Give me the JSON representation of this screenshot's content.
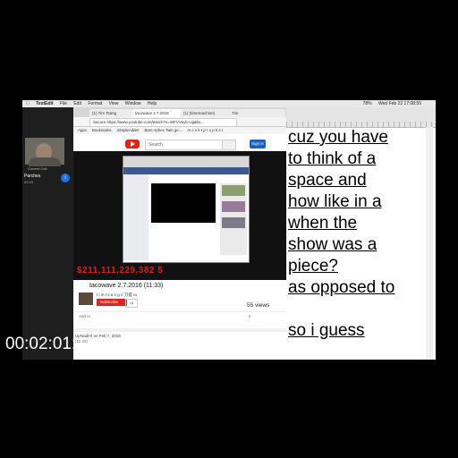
{
  "menubar": {
    "app": "TextEdit",
    "items": [
      "File",
      "Edit",
      "Format",
      "View",
      "Window",
      "Help"
    ],
    "clock": "Wed Feb 22  17:08:55",
    "battery": "78%"
  },
  "call": {
    "label": "Current Call",
    "contact": "Parches",
    "duration": "02:43"
  },
  "browser": {
    "tabs": [
      "(1) Tim Tsang",
      "tacowave 2.7.2016",
      "(1) (timemachine)",
      "Tim"
    ],
    "url": "Secure  https://www.youtube.com/watch?v=WFVVeyb-Ug&lis...",
    "bookmarks": [
      "Apps",
      "Bookmarks",
      "SimpleAdder",
      "Bare Aphex Twin ge...",
      "m o n k • p r o p h e t"
    ],
    "search_placeholder": "Search",
    "signin": "Sign in"
  },
  "video": {
    "money": "$211,111,229,382 5",
    "title": "tacowave 2.7.2016 (11:33)",
    "channel": "t i m t s a n g  // 刀提 ro",
    "subscribe": "Subscribe",
    "sub_count": "16",
    "views": "55 views",
    "add_to": "Add to",
    "likes": "0",
    "uploaded": "Uploaded on Feb 7, 2016",
    "uploaded_sub": "(11:33)"
  },
  "editor": {
    "lines": [
      "cuz you have",
      "to think of a",
      "space and",
      "how like in a",
      "when the",
      "show was a",
      "piece?",
      "as opposed to",
      "",
      "so i guess"
    ]
  },
  "timecode": "00:02:01;12"
}
